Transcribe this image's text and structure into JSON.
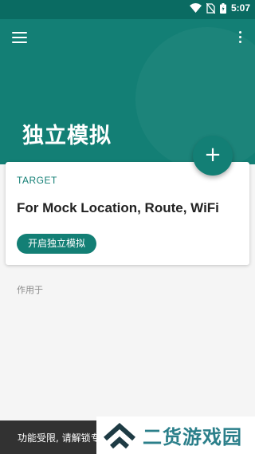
{
  "status_bar": {
    "time": "5:07",
    "icons": [
      "wifi-icon",
      "no-sim-icon",
      "battery-icon"
    ]
  },
  "app_bar": {
    "title": "独立模拟",
    "menu_icon": "hamburger-menu-icon",
    "more_icon": "more-vert-icon"
  },
  "fab": {
    "label": "+",
    "icon": "add-icon"
  },
  "card": {
    "kicker": "TARGET",
    "title": "For Mock Location, Route, WiFi",
    "button_label": "开启独立模拟"
  },
  "section": {
    "label": "作用于"
  },
  "snackbar": {
    "text": "功能受限, 请解锁专"
  },
  "watermark": {
    "text": "二货游戏园",
    "logo_icon": "double-chevron-logo-icon"
  },
  "colors": {
    "primary": "#137f75",
    "primary_dark": "#0a6b62",
    "background": "#f5f5f5",
    "snackbar": "#323232",
    "watermark_text": "#2b7f8a"
  }
}
